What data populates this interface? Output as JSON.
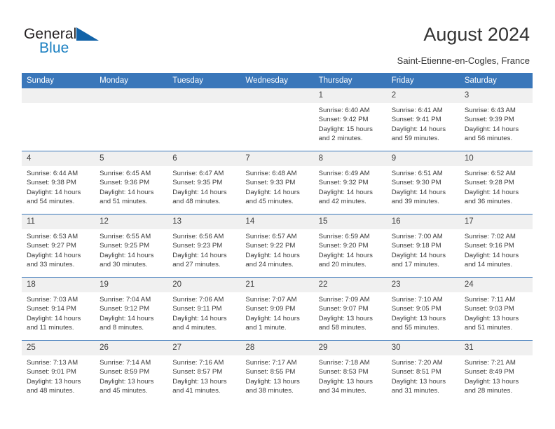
{
  "brand": {
    "name_dark": "General",
    "name_blue": "Blue",
    "logo_icon": "triangle-flag-icon",
    "color_dark": "#231f20",
    "color_blue": "#1a7fc1",
    "color_triangle": "#1263a8"
  },
  "header": {
    "title": "August 2024",
    "subtitle": "Saint-Etienne-en-Cogles, France",
    "accent_color": "#3a77ba",
    "daynum_bg": "#f0f0f0"
  },
  "weekdays": [
    "Sunday",
    "Monday",
    "Tuesday",
    "Wednesday",
    "Thursday",
    "Friday",
    "Saturday"
  ],
  "labels": {
    "sunrise": "Sunrise:",
    "sunset": "Sunset:",
    "daylight": "Daylight:"
  },
  "weeks": [
    [
      {
        "date": "",
        "empty": true,
        "sunrise": "",
        "sunset": "",
        "daylight_1": "",
        "daylight_2": ""
      },
      {
        "date": "",
        "empty": true,
        "sunrise": "",
        "sunset": "",
        "daylight_1": "",
        "daylight_2": ""
      },
      {
        "date": "",
        "empty": true,
        "sunrise": "",
        "sunset": "",
        "daylight_1": "",
        "daylight_2": ""
      },
      {
        "date": "",
        "empty": true,
        "sunrise": "",
        "sunset": "",
        "daylight_1": "",
        "daylight_2": ""
      },
      {
        "date": "1",
        "empty": false,
        "sunrise": "Sunrise: 6:40 AM",
        "sunset": "Sunset: 9:42 PM",
        "daylight_1": "Daylight: 15 hours",
        "daylight_2": "and 2 minutes."
      },
      {
        "date": "2",
        "empty": false,
        "sunrise": "Sunrise: 6:41 AM",
        "sunset": "Sunset: 9:41 PM",
        "daylight_1": "Daylight: 14 hours",
        "daylight_2": "and 59 minutes."
      },
      {
        "date": "3",
        "empty": false,
        "sunrise": "Sunrise: 6:43 AM",
        "sunset": "Sunset: 9:39 PM",
        "daylight_1": "Daylight: 14 hours",
        "daylight_2": "and 56 minutes."
      }
    ],
    [
      {
        "date": "4",
        "empty": false,
        "sunrise": "Sunrise: 6:44 AM",
        "sunset": "Sunset: 9:38 PM",
        "daylight_1": "Daylight: 14 hours",
        "daylight_2": "and 54 minutes."
      },
      {
        "date": "5",
        "empty": false,
        "sunrise": "Sunrise: 6:45 AM",
        "sunset": "Sunset: 9:36 PM",
        "daylight_1": "Daylight: 14 hours",
        "daylight_2": "and 51 minutes."
      },
      {
        "date": "6",
        "empty": false,
        "sunrise": "Sunrise: 6:47 AM",
        "sunset": "Sunset: 9:35 PM",
        "daylight_1": "Daylight: 14 hours",
        "daylight_2": "and 48 minutes."
      },
      {
        "date": "7",
        "empty": false,
        "sunrise": "Sunrise: 6:48 AM",
        "sunset": "Sunset: 9:33 PM",
        "daylight_1": "Daylight: 14 hours",
        "daylight_2": "and 45 minutes."
      },
      {
        "date": "8",
        "empty": false,
        "sunrise": "Sunrise: 6:49 AM",
        "sunset": "Sunset: 9:32 PM",
        "daylight_1": "Daylight: 14 hours",
        "daylight_2": "and 42 minutes."
      },
      {
        "date": "9",
        "empty": false,
        "sunrise": "Sunrise: 6:51 AM",
        "sunset": "Sunset: 9:30 PM",
        "daylight_1": "Daylight: 14 hours",
        "daylight_2": "and 39 minutes."
      },
      {
        "date": "10",
        "empty": false,
        "sunrise": "Sunrise: 6:52 AM",
        "sunset": "Sunset: 9:28 PM",
        "daylight_1": "Daylight: 14 hours",
        "daylight_2": "and 36 minutes."
      }
    ],
    [
      {
        "date": "11",
        "empty": false,
        "sunrise": "Sunrise: 6:53 AM",
        "sunset": "Sunset: 9:27 PM",
        "daylight_1": "Daylight: 14 hours",
        "daylight_2": "and 33 minutes."
      },
      {
        "date": "12",
        "empty": false,
        "sunrise": "Sunrise: 6:55 AM",
        "sunset": "Sunset: 9:25 PM",
        "daylight_1": "Daylight: 14 hours",
        "daylight_2": "and 30 minutes."
      },
      {
        "date": "13",
        "empty": false,
        "sunrise": "Sunrise: 6:56 AM",
        "sunset": "Sunset: 9:23 PM",
        "daylight_1": "Daylight: 14 hours",
        "daylight_2": "and 27 minutes."
      },
      {
        "date": "14",
        "empty": false,
        "sunrise": "Sunrise: 6:57 AM",
        "sunset": "Sunset: 9:22 PM",
        "daylight_1": "Daylight: 14 hours",
        "daylight_2": "and 24 minutes."
      },
      {
        "date": "15",
        "empty": false,
        "sunrise": "Sunrise: 6:59 AM",
        "sunset": "Sunset: 9:20 PM",
        "daylight_1": "Daylight: 14 hours",
        "daylight_2": "and 20 minutes."
      },
      {
        "date": "16",
        "empty": false,
        "sunrise": "Sunrise: 7:00 AM",
        "sunset": "Sunset: 9:18 PM",
        "daylight_1": "Daylight: 14 hours",
        "daylight_2": "and 17 minutes."
      },
      {
        "date": "17",
        "empty": false,
        "sunrise": "Sunrise: 7:02 AM",
        "sunset": "Sunset: 9:16 PM",
        "daylight_1": "Daylight: 14 hours",
        "daylight_2": "and 14 minutes."
      }
    ],
    [
      {
        "date": "18",
        "empty": false,
        "sunrise": "Sunrise: 7:03 AM",
        "sunset": "Sunset: 9:14 PM",
        "daylight_1": "Daylight: 14 hours",
        "daylight_2": "and 11 minutes."
      },
      {
        "date": "19",
        "empty": false,
        "sunrise": "Sunrise: 7:04 AM",
        "sunset": "Sunset: 9:12 PM",
        "daylight_1": "Daylight: 14 hours",
        "daylight_2": "and 8 minutes."
      },
      {
        "date": "20",
        "empty": false,
        "sunrise": "Sunrise: 7:06 AM",
        "sunset": "Sunset: 9:11 PM",
        "daylight_1": "Daylight: 14 hours",
        "daylight_2": "and 4 minutes."
      },
      {
        "date": "21",
        "empty": false,
        "sunrise": "Sunrise: 7:07 AM",
        "sunset": "Sunset: 9:09 PM",
        "daylight_1": "Daylight: 14 hours",
        "daylight_2": "and 1 minute."
      },
      {
        "date": "22",
        "empty": false,
        "sunrise": "Sunrise: 7:09 AM",
        "sunset": "Sunset: 9:07 PM",
        "daylight_1": "Daylight: 13 hours",
        "daylight_2": "and 58 minutes."
      },
      {
        "date": "23",
        "empty": false,
        "sunrise": "Sunrise: 7:10 AM",
        "sunset": "Sunset: 9:05 PM",
        "daylight_1": "Daylight: 13 hours",
        "daylight_2": "and 55 minutes."
      },
      {
        "date": "24",
        "empty": false,
        "sunrise": "Sunrise: 7:11 AM",
        "sunset": "Sunset: 9:03 PM",
        "daylight_1": "Daylight: 13 hours",
        "daylight_2": "and 51 minutes."
      }
    ],
    [
      {
        "date": "25",
        "empty": false,
        "sunrise": "Sunrise: 7:13 AM",
        "sunset": "Sunset: 9:01 PM",
        "daylight_1": "Daylight: 13 hours",
        "daylight_2": "and 48 minutes."
      },
      {
        "date": "26",
        "empty": false,
        "sunrise": "Sunrise: 7:14 AM",
        "sunset": "Sunset: 8:59 PM",
        "daylight_1": "Daylight: 13 hours",
        "daylight_2": "and 45 minutes."
      },
      {
        "date": "27",
        "empty": false,
        "sunrise": "Sunrise: 7:16 AM",
        "sunset": "Sunset: 8:57 PM",
        "daylight_1": "Daylight: 13 hours",
        "daylight_2": "and 41 minutes."
      },
      {
        "date": "28",
        "empty": false,
        "sunrise": "Sunrise: 7:17 AM",
        "sunset": "Sunset: 8:55 PM",
        "daylight_1": "Daylight: 13 hours",
        "daylight_2": "and 38 minutes."
      },
      {
        "date": "29",
        "empty": false,
        "sunrise": "Sunrise: 7:18 AM",
        "sunset": "Sunset: 8:53 PM",
        "daylight_1": "Daylight: 13 hours",
        "daylight_2": "and 34 minutes."
      },
      {
        "date": "30",
        "empty": false,
        "sunrise": "Sunrise: 7:20 AM",
        "sunset": "Sunset: 8:51 PM",
        "daylight_1": "Daylight: 13 hours",
        "daylight_2": "and 31 minutes."
      },
      {
        "date": "31",
        "empty": false,
        "sunrise": "Sunrise: 7:21 AM",
        "sunset": "Sunset: 8:49 PM",
        "daylight_1": "Daylight: 13 hours",
        "daylight_2": "and 28 minutes."
      }
    ]
  ]
}
